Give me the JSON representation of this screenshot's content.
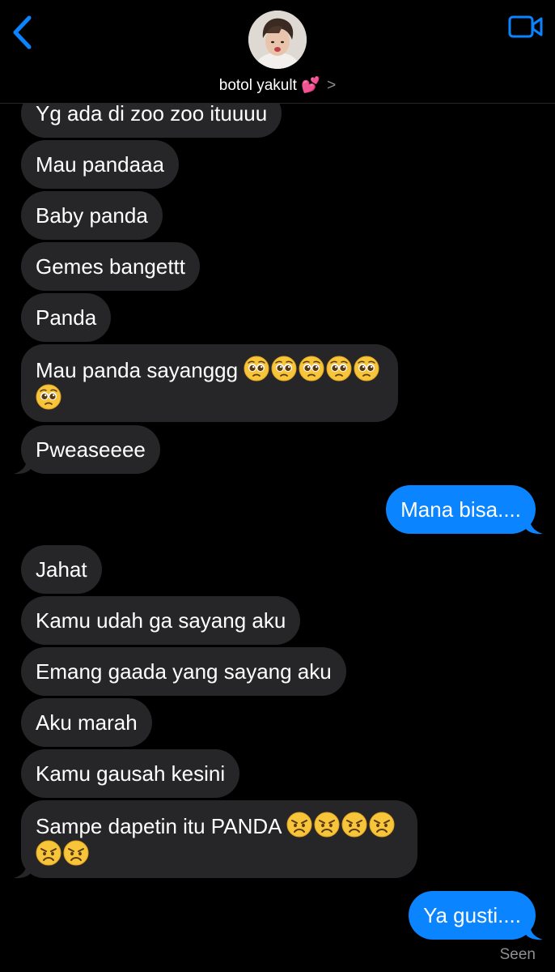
{
  "header": {
    "contact_name": "botol yakult",
    "name_emoji": "💕",
    "chevron": ">",
    "icons": {
      "back": "chevron-left-icon",
      "video": "video-camera-icon"
    },
    "accent_color": "#0a84ff"
  },
  "messages": [
    {
      "dir": "received",
      "text": "Yg ada di zoo zoo ituuuu"
    },
    {
      "dir": "received",
      "text": "Mau pandaaa"
    },
    {
      "dir": "received",
      "text": "Baby panda"
    },
    {
      "dir": "received",
      "text": "Gemes bangettt"
    },
    {
      "dir": "received",
      "text": "Panda"
    },
    {
      "dir": "received",
      "text": "Mau panda sayanggg",
      "emoji": "pleading-face",
      "emoji_count": 6
    },
    {
      "dir": "received",
      "text": "Pweaseeee"
    },
    {
      "dir": "sent",
      "text": "Mana bisa...."
    },
    {
      "dir": "received",
      "text": "Jahat"
    },
    {
      "dir": "received",
      "text": "Kamu udah ga sayang aku"
    },
    {
      "dir": "received",
      "text": "Emang gaada yang sayang aku"
    },
    {
      "dir": "received",
      "text": "Aku marah"
    },
    {
      "dir": "received",
      "text": "Kamu gausah kesini"
    },
    {
      "dir": "received",
      "text": "Sampe dapetin itu PANDA",
      "emoji": "angry-face",
      "emoji_count": 6
    },
    {
      "dir": "sent",
      "text": "Ya gusti...."
    }
  ],
  "status": {
    "seen": "Seen"
  },
  "colors": {
    "received_bubble": "#262628",
    "sent_bubble": "#0a84ff",
    "background": "#000000"
  }
}
